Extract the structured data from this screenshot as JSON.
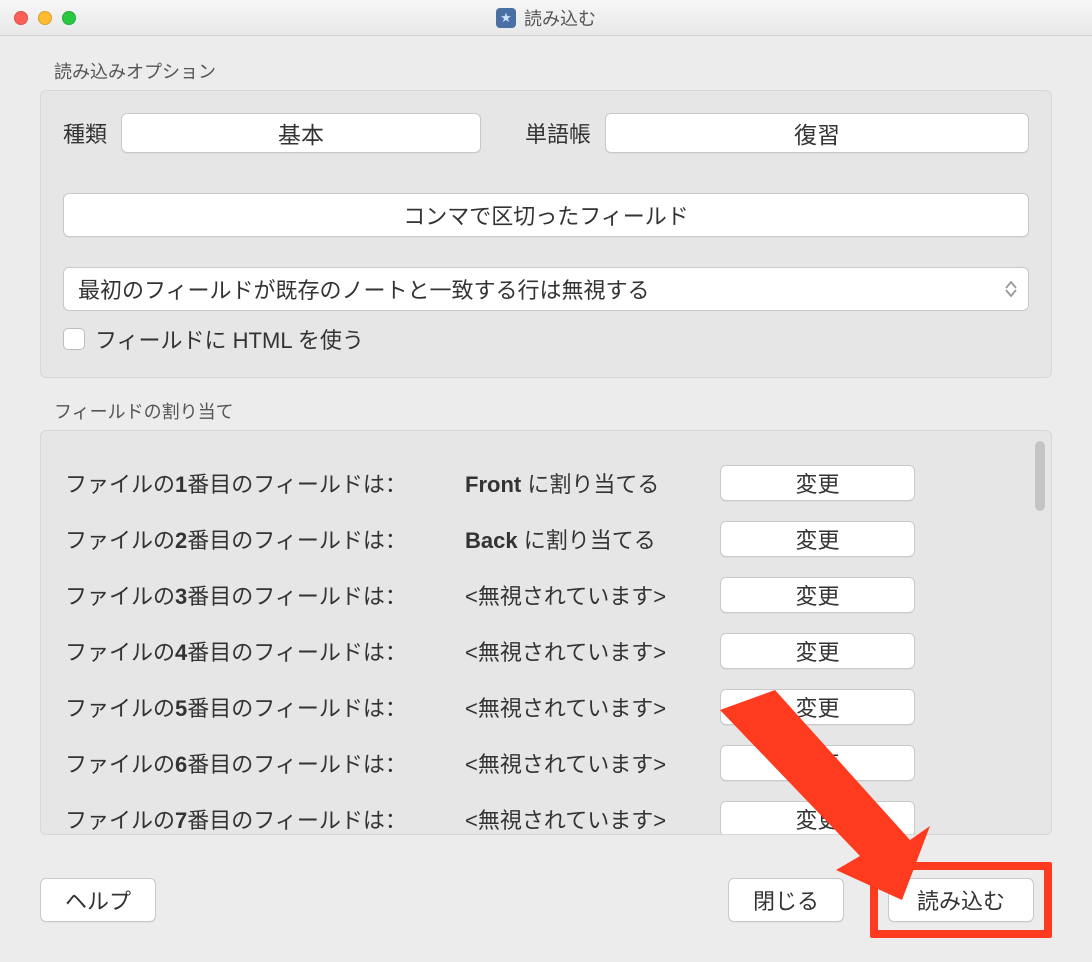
{
  "titlebar": {
    "title": "読み込む"
  },
  "sections": {
    "options_label": "読み込みオプション",
    "mapping_label": "フィールドの割り当て"
  },
  "options": {
    "type_label": "種類",
    "type_value": "基本",
    "deck_label": "単語帳",
    "deck_value": "復習",
    "delimiter_button": "コンマで区切ったフィールド",
    "duplicate_select": "最初のフィールドが既存のノートと一致する行は無視する",
    "html_checkbox_label": "フィールドに HTML を使う"
  },
  "mapping": {
    "left_prefix": "ファイルの",
    "left_suffix": "番目のフィールドは：",
    "mid_suffix": " に割り当てる",
    "ignored": "<無視されています>",
    "change_button": "変更",
    "rows": [
      {
        "n": "1",
        "target": "Front"
      },
      {
        "n": "2",
        "target": "Back"
      },
      {
        "n": "3",
        "target": null
      },
      {
        "n": "4",
        "target": null
      },
      {
        "n": "5",
        "target": null
      },
      {
        "n": "6",
        "target": null
      },
      {
        "n": "7",
        "target": null
      }
    ]
  },
  "footer": {
    "help": "ヘルプ",
    "close": "閉じる",
    "import": "読み込む"
  }
}
